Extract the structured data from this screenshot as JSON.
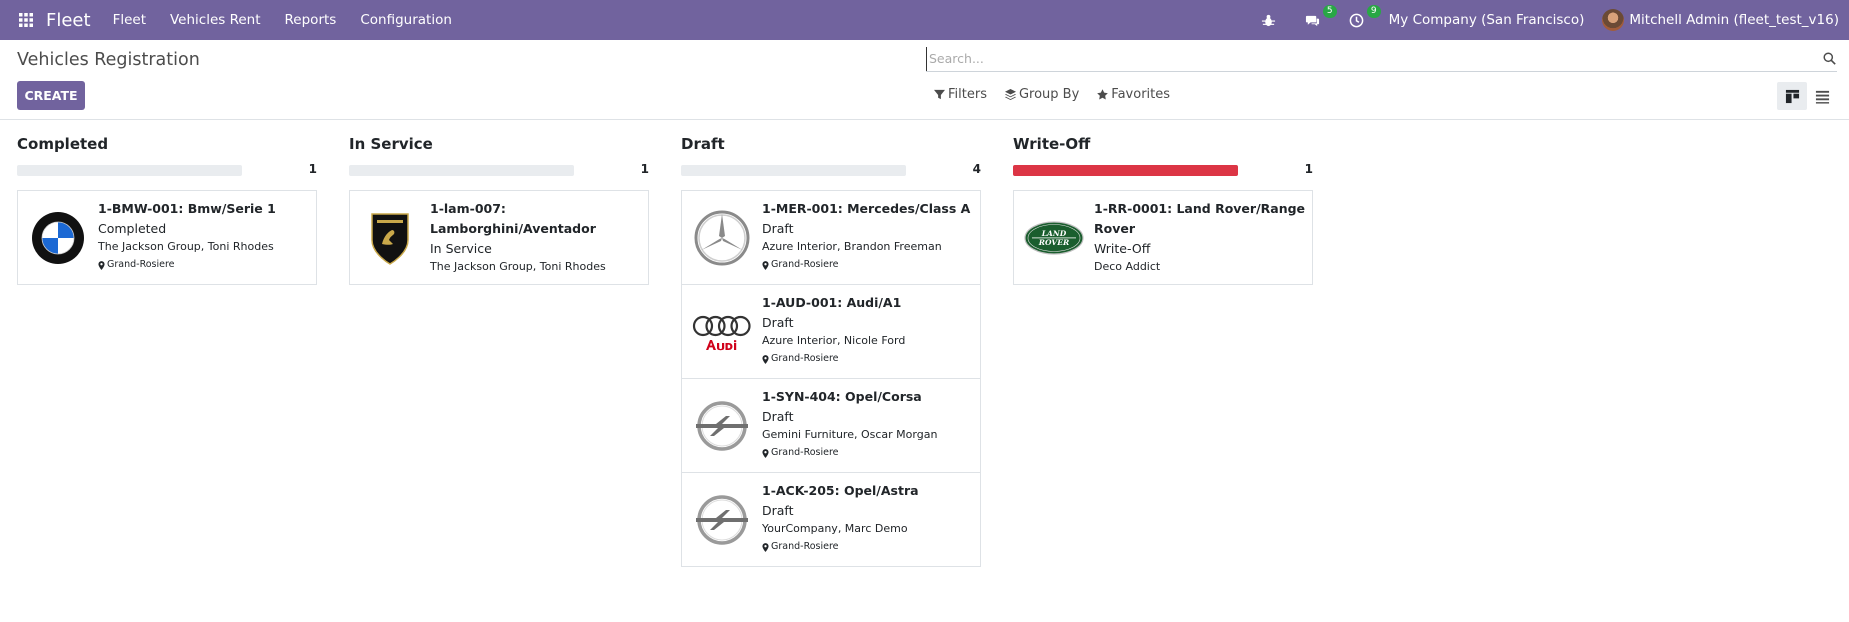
{
  "navbar": {
    "app_name": "Fleet",
    "menu": [
      "Fleet",
      "Vehicles Rent",
      "Reports",
      "Configuration"
    ],
    "messages_count": "5",
    "activities_count": "9",
    "company": "My Company (San Francisco)",
    "user": "Mitchell Admin (fleet_test_v16)"
  },
  "control_panel": {
    "title": "Vehicles Registration",
    "create_label": "CREATE",
    "search_placeholder": "Search...",
    "filters_label": "Filters",
    "group_by_label": "Group By",
    "favorites_label": "Favorites"
  },
  "colors": {
    "brand": "#71639e",
    "write_off_bar": "#dc3545",
    "badge": "#28a745"
  },
  "columns": [
    {
      "title": "Completed",
      "count": "1",
      "bar_fill_fraction": 0,
      "cards": [
        {
          "title_line1": "1-BMW-001: Bmw/Serie 1",
          "title_line2": "",
          "state": "Completed",
          "owner": "The Jackson Group, Toni Rhodes",
          "location": "Grand-Rosiere",
          "logo": "bmw-logo"
        }
      ]
    },
    {
      "title": "In Service",
      "count": "1",
      "bar_fill_fraction": 0,
      "cards": [
        {
          "title_line1": "1-lam-007:",
          "title_line2": "Lamborghini/Aventador",
          "state": "In Service",
          "owner": "The Jackson Group, Toni Rhodes",
          "location": "",
          "logo": "lamborghini-logo"
        }
      ]
    },
    {
      "title": "Draft",
      "count": "4",
      "bar_fill_fraction": 0,
      "cards": [
        {
          "title_line1": "1-MER-001: Mercedes/Class A",
          "title_line2": "",
          "state": "Draft",
          "owner": "Azure Interior, Brandon Freeman",
          "location": "Grand-Rosiere",
          "logo": "mercedes-logo"
        },
        {
          "title_line1": "1-AUD-001: Audi/A1",
          "title_line2": "",
          "state": "Draft",
          "owner": "Azure Interior, Nicole Ford",
          "location": "Grand-Rosiere",
          "logo": "audi-logo"
        },
        {
          "title_line1": "1-SYN-404: Opel/Corsa",
          "title_line2": "",
          "state": "Draft",
          "owner": "Gemini Furniture, Oscar Morgan",
          "location": "Grand-Rosiere",
          "logo": "opel-logo"
        },
        {
          "title_line1": "1-ACK-205: Opel/Astra",
          "title_line2": "",
          "state": "Draft",
          "owner": "YourCompany, Marc Demo",
          "location": "Grand-Rosiere",
          "logo": "opel-logo"
        }
      ]
    },
    {
      "title": "Write-Off",
      "count": "1",
      "bar_fill_fraction": 1,
      "cards": [
        {
          "title_line1": "1-RR-0001: Land Rover/Range",
          "title_line2": "Rover",
          "state": "Write-Off",
          "owner": "Deco Addict",
          "location": "",
          "logo": "land-rover-logo"
        }
      ]
    }
  ]
}
